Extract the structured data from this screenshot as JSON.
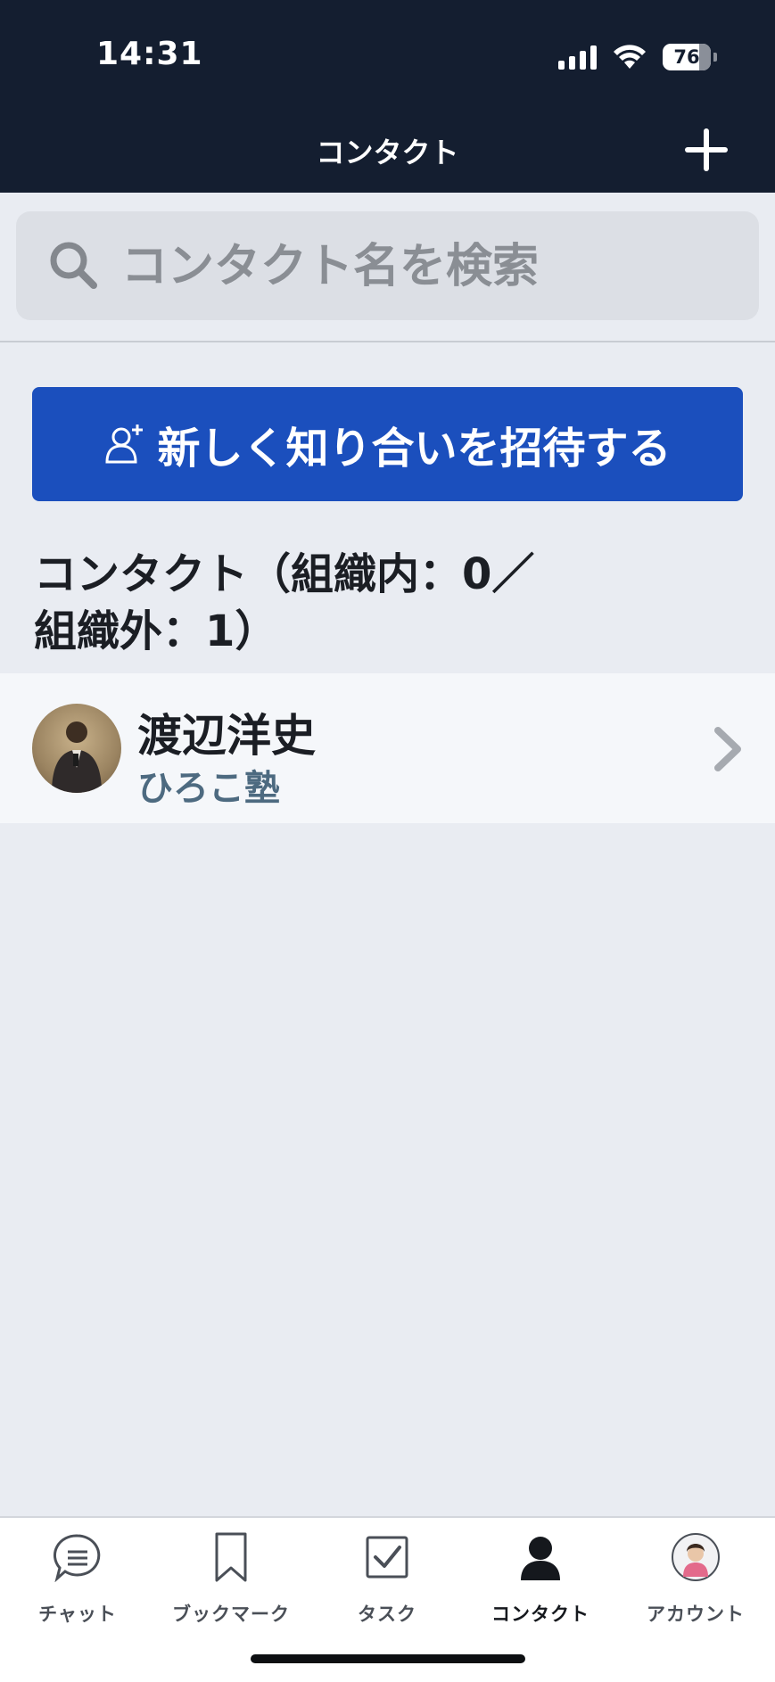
{
  "status_bar": {
    "time": "14:31",
    "battery": "76"
  },
  "header": {
    "title": "コンタクト"
  },
  "search": {
    "placeholder": "コンタクト名を検索"
  },
  "invite_button": {
    "label": "新しく知り合いを招待する"
  },
  "section": {
    "title_line1": "コンタクト（組織内：0／",
    "title_line2": "組織外：1）"
  },
  "contacts": [
    {
      "name": "渡辺洋史",
      "organization": "ひろこ塾"
    }
  ],
  "tabs": [
    {
      "label": "チャット",
      "icon": "chat-icon"
    },
    {
      "label": "ブックマーク",
      "icon": "bookmark-icon"
    },
    {
      "label": "タスク",
      "icon": "task-checkbox-icon"
    },
    {
      "label": "コンタクト",
      "icon": "person-icon",
      "active": true
    },
    {
      "label": "アカウント",
      "icon": "account-avatar-icon"
    }
  ],
  "colors": {
    "header_bg": "#141e30",
    "accent": "#1b4fbd",
    "org_text": "#4d6a80"
  }
}
